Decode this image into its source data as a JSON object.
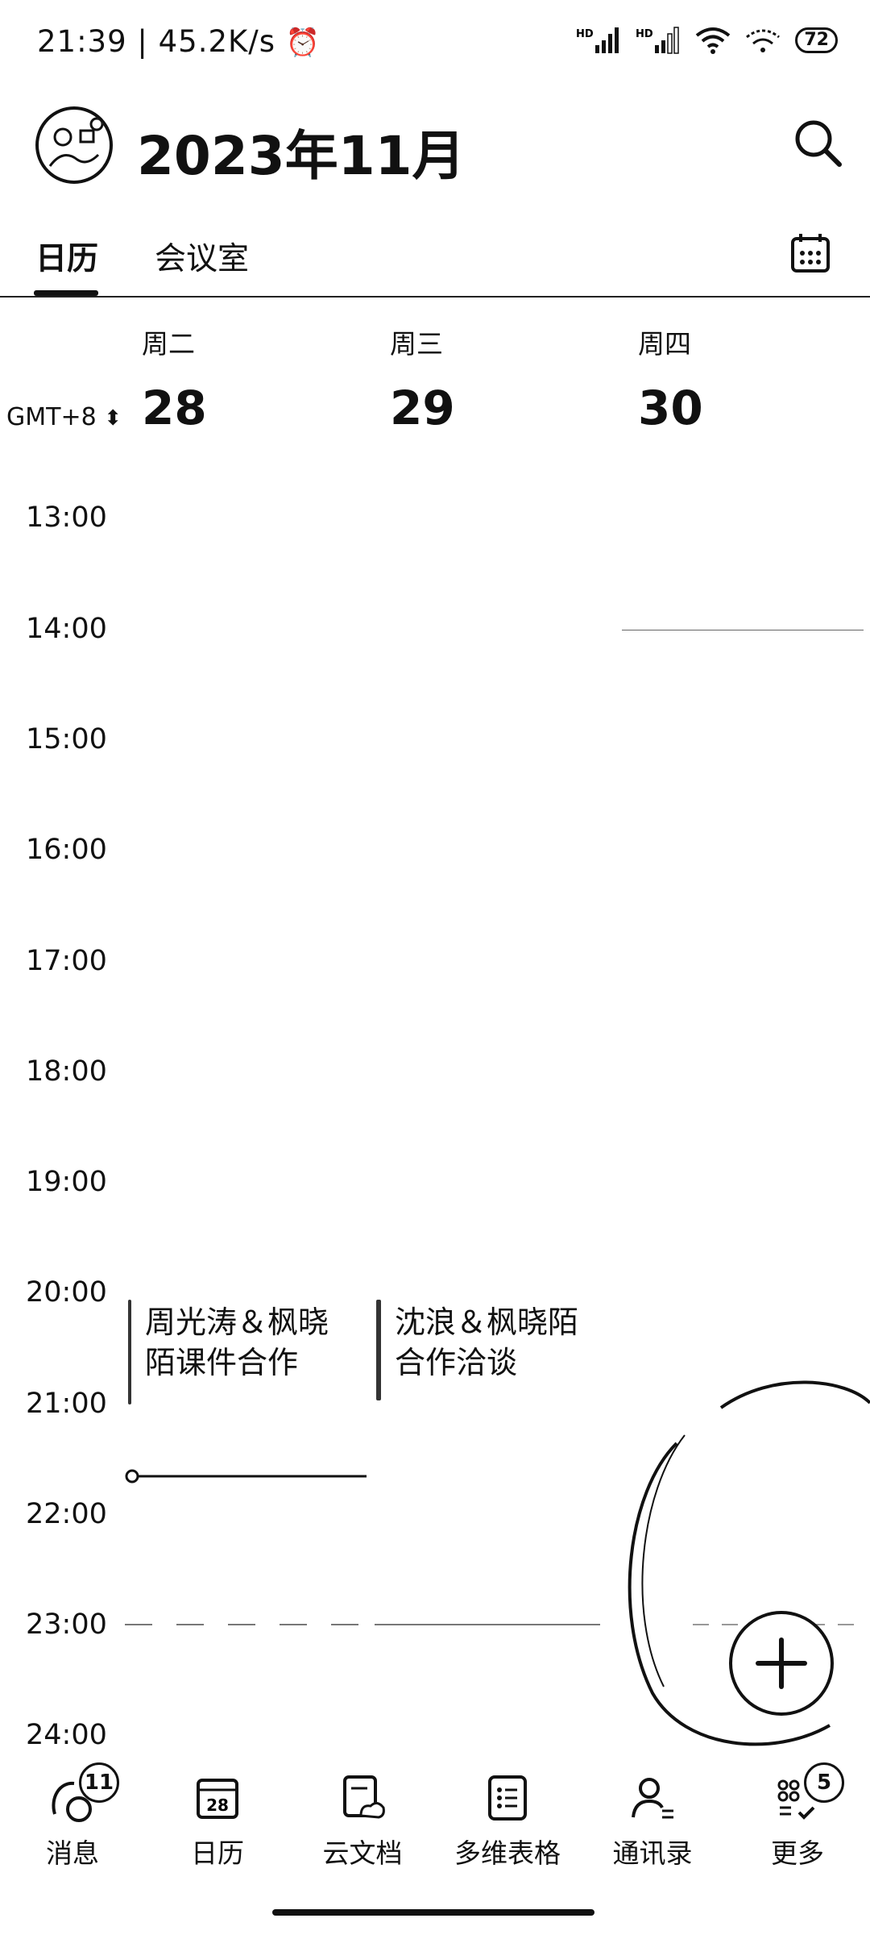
{
  "status_bar": {
    "time": "21:39",
    "speed": "45.2K/s",
    "battery": "72"
  },
  "header": {
    "title": "2023年11月",
    "icons": {
      "search": "search-icon",
      "avatar": "avatar",
      "calendar": "calendar-grid-icon"
    }
  },
  "tabs": [
    {
      "label": "日历",
      "active": true
    },
    {
      "label": "会议室",
      "active": false
    }
  ],
  "timezone": "GMT+8",
  "days": [
    {
      "weekday": "周二",
      "date": "28"
    },
    {
      "weekday": "周三",
      "date": "29"
    },
    {
      "weekday": "周四",
      "date": "30"
    }
  ],
  "hours": [
    "13:00",
    "14:00",
    "15:00",
    "16:00",
    "17:00",
    "18:00",
    "19:00",
    "20:00",
    "21:00",
    "22:00",
    "23:00",
    "24:00"
  ],
  "events": [
    {
      "title_line1": "周光涛＆枫晓",
      "title_line2": "陌课件合作",
      "day": "周二"
    },
    {
      "title_line1": "沈浪＆枫晓陌",
      "title_line2": "合作洽谈",
      "day": "周三"
    }
  ],
  "nav": [
    {
      "label": "消息",
      "icon": "message-icon",
      "badge": "11"
    },
    {
      "label": "日历",
      "icon": "calendar-icon",
      "icon_text": "28"
    },
    {
      "label": "云文档",
      "icon": "cloud-doc-icon"
    },
    {
      "label": "多维表格",
      "icon": "table-icon"
    },
    {
      "label": "通讯录",
      "icon": "contacts-icon"
    },
    {
      "label": "更多",
      "icon": "more-apps-icon",
      "badge": "5"
    }
  ]
}
